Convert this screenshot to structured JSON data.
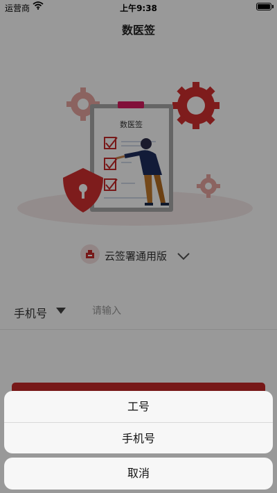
{
  "status_bar": {
    "carrier": "运营商",
    "time": "上午9:38"
  },
  "nav": {
    "title": "数医签"
  },
  "illustration": {
    "doc_title": "数医签"
  },
  "cert": {
    "label": "云签署通用版"
  },
  "form": {
    "phone_type": "手机号",
    "placeholder": "请输入"
  },
  "action_sheet": {
    "options": [
      {
        "label": "工号"
      },
      {
        "label": "手机号"
      }
    ],
    "cancel": "取消"
  },
  "colors": {
    "brand_red": "#c62828",
    "overlay": "rgba(0,0,0,0.4)"
  }
}
